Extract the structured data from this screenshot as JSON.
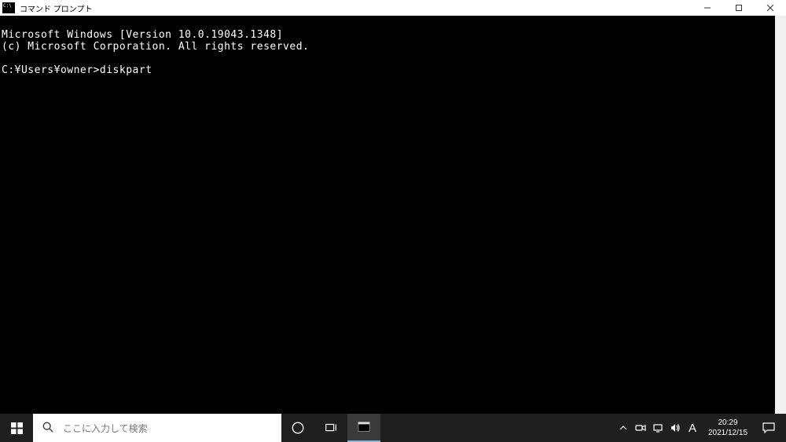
{
  "titlebar": {
    "title": "コマンド プロンプト"
  },
  "terminal": {
    "line1": "Microsoft Windows [Version 10.0.19043.1348]",
    "line2": "(c) Microsoft Corporation. All rights reserved.",
    "prompt": "C:¥Users¥owner>",
    "command": "diskpart"
  },
  "taskbar": {
    "search_placeholder": "ここに入力して検索",
    "ime_indicator": "A",
    "time": "20:29",
    "date": "2021/12/15"
  }
}
